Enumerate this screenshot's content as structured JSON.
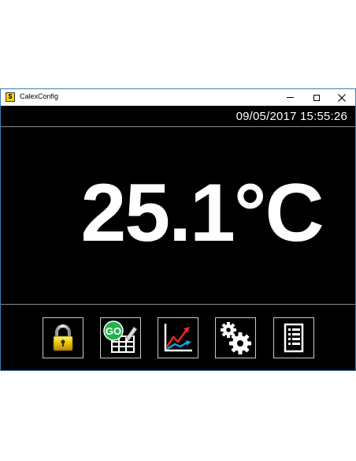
{
  "window": {
    "title": "CalexConfig",
    "app_icon_glyph": "$",
    "minimize_icon": "minimize-icon",
    "maximize_icon": "maximize-icon",
    "close_icon": "close-icon"
  },
  "header": {
    "datetime": "09/05/2017 15:55:26"
  },
  "reading": {
    "value": "25.1°C"
  },
  "toolbar": {
    "buttons": [
      {
        "icon": "lock-icon"
      },
      {
        "icon": "go-spreadsheet-icon",
        "badge": "GO"
      },
      {
        "icon": "chart-icon"
      },
      {
        "icon": "gears-icon"
      },
      {
        "icon": "list-icon"
      }
    ]
  },
  "colors": {
    "background": "#000000",
    "text": "#ffffff",
    "window_border": "#3c7fb1",
    "go_badge": "#22b14c",
    "chart_red": "#e8242b",
    "chart_blue": "#1a9fe0",
    "lock_gold": "#e8c200"
  }
}
